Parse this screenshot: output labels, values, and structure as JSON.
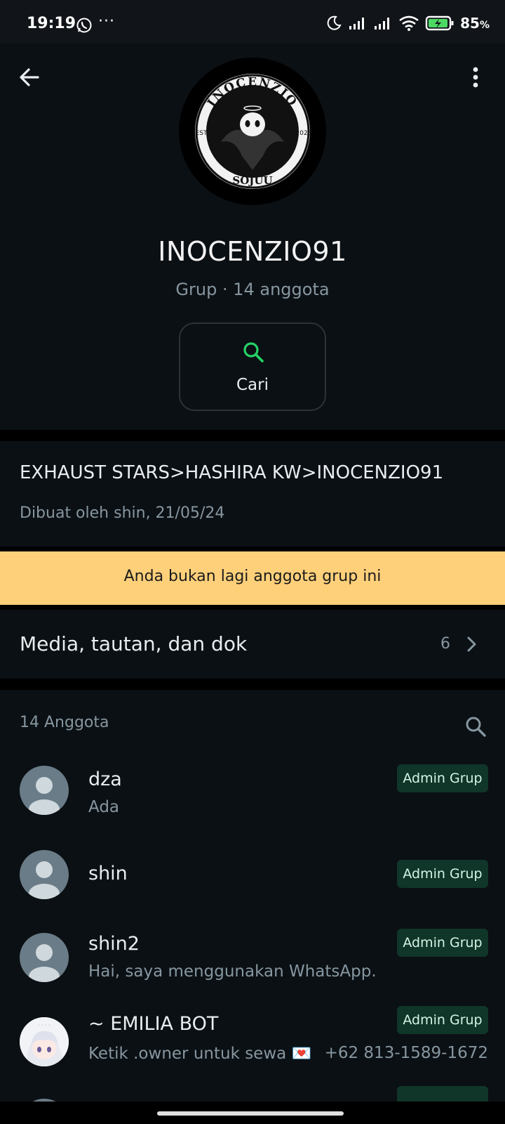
{
  "status_bar": {
    "time": "19:19",
    "notification_icons": [
      "whatsapp-icon",
      "more-dots-icon"
    ],
    "dots": "···",
    "right_icons": [
      "moon-icon",
      "signal-icon",
      "signal-icon",
      "wifi-icon",
      "battery-charging-icon"
    ],
    "battery": "85",
    "battery_unit": "%"
  },
  "header": {
    "back_icon": "arrow-left-icon",
    "menu_icon": "more-vertical-icon",
    "avatar_text_top": "INOCENZIO",
    "avatar_text_bottom": "SOJUU",
    "avatar_text_left": "EST",
    "avatar_text_right": "2023",
    "title": "INOCENZIO91",
    "subtitle": "Grup · 14 anggota",
    "search_label": "Cari"
  },
  "description": {
    "text": "EXHAUST STARS>HASHIRA KW>INOCENZIO91",
    "created": "Dibuat oleh shin, 21/05/24"
  },
  "banner": {
    "text": "Anda bukan lagi anggota grup ini"
  },
  "media": {
    "label": "Media, tautan, dan dok",
    "count": "6"
  },
  "members": {
    "title": "14 Anggota",
    "list": [
      {
        "name": "dza",
        "status": "Ada",
        "badge": "Admin Grup",
        "phone": ""
      },
      {
        "name": "shin",
        "status": "",
        "badge": "Admin Grup",
        "phone": ""
      },
      {
        "name": "shin2",
        "status": "Hai, saya menggunakan WhatsApp.",
        "badge": "Admin Grup",
        "phone": ""
      },
      {
        "name": "~ EMILIA BOT",
        "status": "Ketik .owner untuk sewa 💌",
        "badge": "Admin Grup",
        "phone": "+62 813-1589-1672"
      },
      {
        "name": "",
        "status": "",
        "badge": "",
        "phone": ""
      }
    ]
  },
  "colors": {
    "background": "#0b1014",
    "accent_green": "#25d366",
    "banner_bg": "#ffd07a",
    "badge_bg": "#103529",
    "muted_text": "#8696a0"
  }
}
